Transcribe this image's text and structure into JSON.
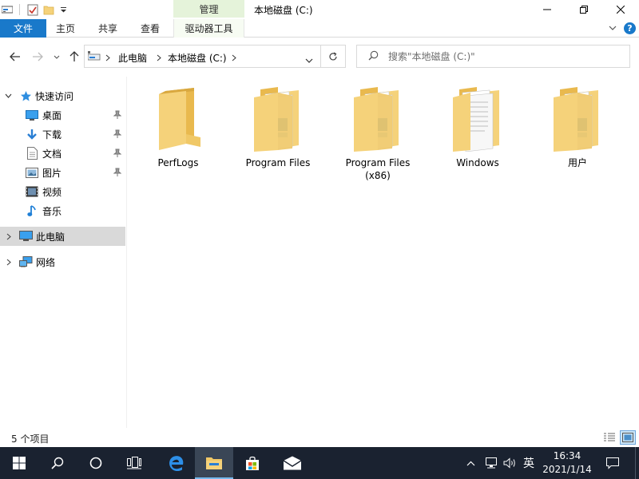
{
  "window": {
    "title": "本地磁盘 (C:)",
    "context_group": "管理"
  },
  "ribbon": {
    "tabs": [
      {
        "label": "文件"
      },
      {
        "label": "主页"
      },
      {
        "label": "共享"
      },
      {
        "label": "查看"
      },
      {
        "label": "驱动器工具"
      }
    ]
  },
  "address": {
    "breadcrumbs": [
      "此电脑",
      "本地磁盘 (C:)"
    ],
    "search_placeholder": "搜索\"本地磁盘 (C:)\""
  },
  "nav": {
    "quick_access": "快速访问",
    "pinned": [
      {
        "label": "桌面",
        "icon": "desktop-icon"
      },
      {
        "label": "下载",
        "icon": "download-icon"
      },
      {
        "label": "文档",
        "icon": "document-icon"
      },
      {
        "label": "图片",
        "icon": "picture-icon"
      }
    ],
    "libraries": [
      {
        "label": "视频",
        "icon": "video-icon"
      },
      {
        "label": "音乐",
        "icon": "music-icon"
      }
    ],
    "this_pc": "此电脑",
    "network": "网络"
  },
  "files": [
    {
      "name": "PerfLogs",
      "icon": "empty-folder-icon"
    },
    {
      "name": "Program Files",
      "icon": "folder-icon"
    },
    {
      "name": "Program Files (x86)",
      "icon": "folder-icon"
    },
    {
      "name": "Windows",
      "icon": "folder-documents-icon"
    },
    {
      "name": "用户",
      "icon": "folder-icon"
    }
  ],
  "status": {
    "item_count": "5 个项目"
  },
  "taskbar": {
    "ime": "英",
    "time": "16:34",
    "date": "2021/1/14"
  },
  "colors": {
    "accent": "#1979ca",
    "context_tab": "#e5f3da",
    "folder": "#f5d27a",
    "taskbar": "#1a2230"
  }
}
